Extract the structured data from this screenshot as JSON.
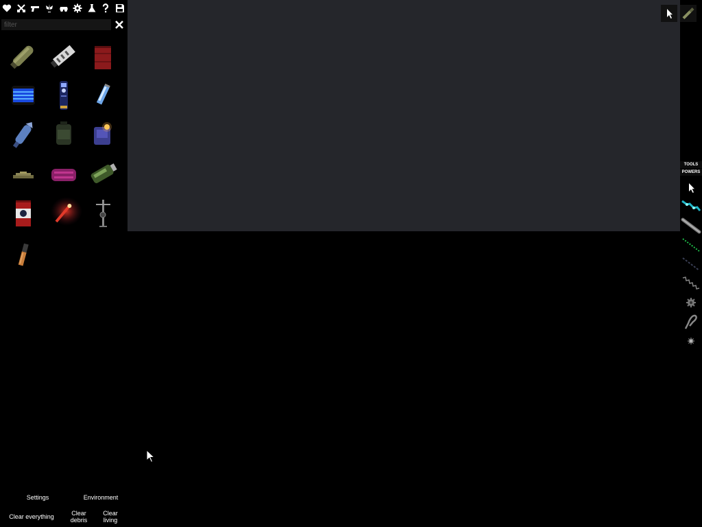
{
  "categories": [
    {
      "name": "heart-icon"
    },
    {
      "name": "crossed-swords-icon"
    },
    {
      "name": "gun-icon"
    },
    {
      "name": "plant-icon"
    },
    {
      "name": "vehicle-icon"
    },
    {
      "name": "gear-icon"
    },
    {
      "name": "flask-icon"
    },
    {
      "name": "question-icon"
    },
    {
      "name": "save-icon"
    }
  ],
  "filter": {
    "placeholder": "filter",
    "value": ""
  },
  "items": [
    {
      "name": "item-olive-bomb"
    },
    {
      "name": "item-white-canister"
    },
    {
      "name": "item-red-barrel"
    },
    {
      "name": "item-blue-light-panel"
    },
    {
      "name": "item-blue-rocket"
    },
    {
      "name": "item-blue-vial"
    },
    {
      "name": "item-blue-missile"
    },
    {
      "name": "item-green-mine"
    },
    {
      "name": "item-purple-lamp"
    },
    {
      "name": "item-flat-landmine"
    },
    {
      "name": "item-magenta-cylinder"
    },
    {
      "name": "item-green-grenade"
    },
    {
      "name": "item-red-flag-canister"
    },
    {
      "name": "item-flare"
    },
    {
      "name": "item-stand-tripod"
    },
    {
      "name": "item-small-torch"
    }
  ],
  "bottom_menu": {
    "settings": "Settings",
    "environment": "Environment",
    "clear_everything": "Clear everything",
    "clear_debris_1": "Clear",
    "clear_debris_2": "debris",
    "clear_living_1": "Clear",
    "clear_living_2": "living"
  },
  "right_bar": {
    "tools_tab": "TOOLS",
    "powers_tab": "POWERS",
    "tools": [
      {
        "name": "pointer-tool-icon"
      },
      {
        "name": "cyan-cable-tool-icon"
      },
      {
        "name": "steel-rod-tool-icon"
      },
      {
        "name": "green-chain-tool-icon"
      },
      {
        "name": "dark-rope-tool-icon"
      },
      {
        "name": "spring-tool-icon"
      },
      {
        "name": "gear-joint-tool-icon"
      },
      {
        "name": "hook-tool-icon"
      },
      {
        "name": "spark-tool-icon"
      }
    ]
  },
  "top_tools": [
    {
      "name": "cursor-mode-icon"
    },
    {
      "name": "knife-tool-icon"
    }
  ],
  "colors": {
    "play_area": "#25262b",
    "background": "#000000"
  }
}
